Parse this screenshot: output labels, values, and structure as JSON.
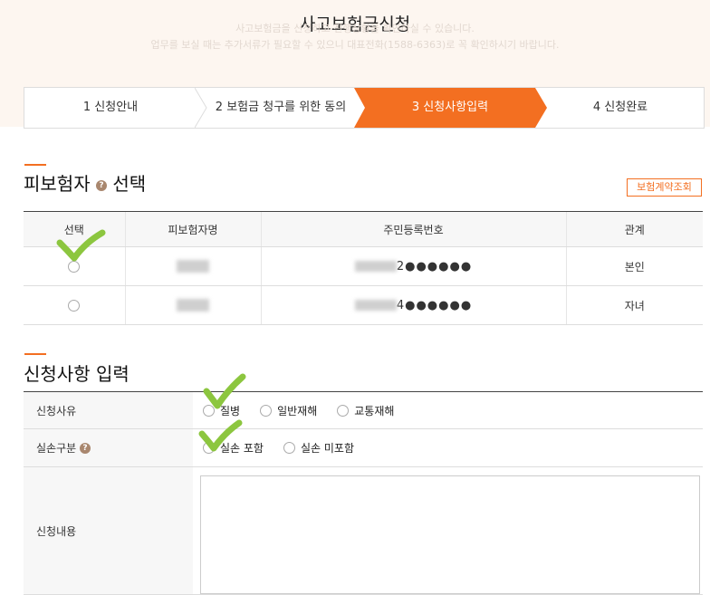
{
  "page": {
    "title": "사고보험금신청",
    "notice_line1": "사고보험금을 신청하고 진행상황을 확인하실 수 있습니다.",
    "notice_line2": "업무를 보실 때는 추가서류가 필요할 수 있으니 대표전화(1588-6363)로 꼭 확인하시기 바랍니다."
  },
  "steps": [
    {
      "label": "1 신청안내"
    },
    {
      "label": "2 보험금 청구를 위한 동의"
    },
    {
      "label": "3 신청사항입력"
    },
    {
      "label": "4 신청완료"
    }
  ],
  "insured": {
    "section_title": "피보험자",
    "section_title_suffix": "선택",
    "lookup_button": "보험계약조회",
    "columns": [
      "선택",
      "피보험자명",
      "주민등록번호",
      "관계"
    ],
    "rows": [
      {
        "rrn_tail": "2●●●●●●",
        "relation": "본인",
        "selected": true
      },
      {
        "rrn_tail": "4●●●●●●",
        "relation": "자녀",
        "selected": false
      }
    ]
  },
  "apply": {
    "section_title": "신청사항 입력",
    "reason_label": "신청사유",
    "reason_options": [
      "질병",
      "일반재해",
      "교통재해"
    ],
    "loss_label": "실손구분",
    "loss_options": [
      "실손 포함",
      "실손 미포함"
    ],
    "content_label": "신청내용"
  },
  "icons": {
    "help": "question-icon",
    "check": "checkmark-icon"
  },
  "colors": {
    "accent": "#f36f21",
    "check": "#8cc63f"
  }
}
